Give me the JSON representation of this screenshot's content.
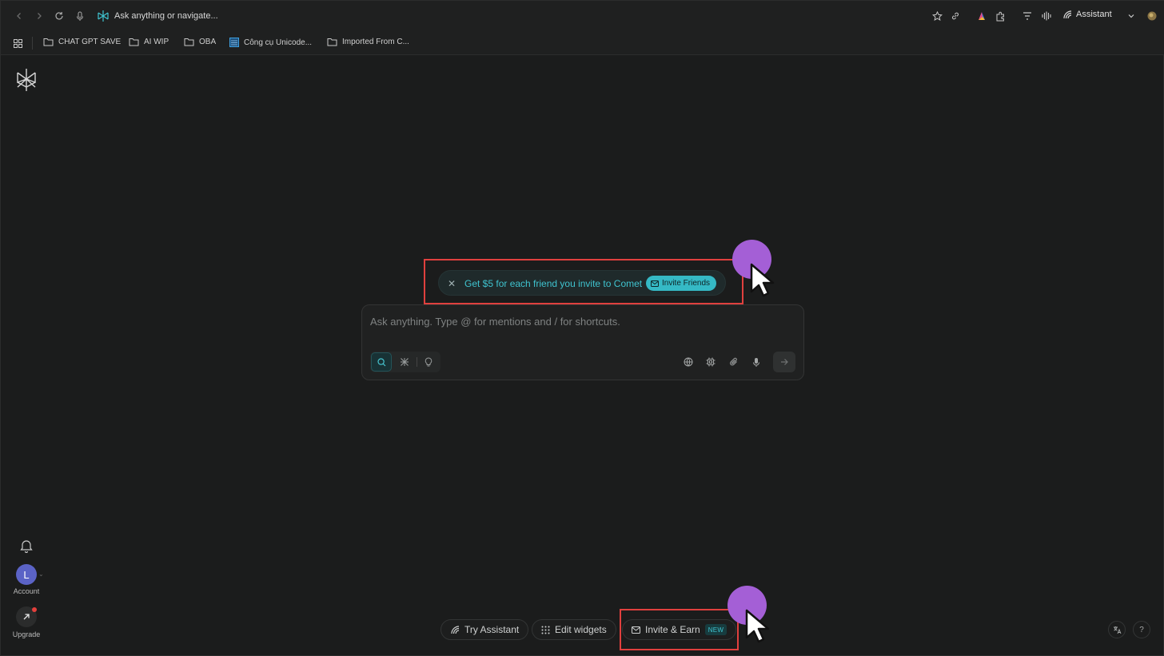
{
  "toolbar": {
    "omnibox_placeholder": "Ask anything or navigate...",
    "assistant_label": "Assistant"
  },
  "bookmarks": [
    {
      "label": "CHAT GPT SAVE",
      "icon": "folder-icon"
    },
    {
      "label": "AI WIP",
      "icon": "folder-icon"
    },
    {
      "label": "OBA",
      "icon": "folder-icon"
    },
    {
      "label": "Công cụ Unicode...",
      "icon": "unicode-icon"
    },
    {
      "label": "Imported From C...",
      "icon": "folder-icon"
    }
  ],
  "sidebar": {
    "avatar_initial": "L",
    "account_label": "Account",
    "upgrade_label": "Upgrade"
  },
  "promo": {
    "text": "Get $5 for each friend you invite to Comet",
    "button_label": "Invite Friends"
  },
  "composer": {
    "placeholder": "Ask anything. Type @ for mentions and / for shortcuts."
  },
  "bottom": {
    "try_assistant": "Try Assistant",
    "edit_widgets": "Edit widgets",
    "invite_earn": "Invite & Earn",
    "new_badge": "NEW"
  },
  "colors": {
    "background": "#1b1c1c",
    "accent": "#3fc3cf",
    "highlight": "#e0403e",
    "cursor_dot": "#a45fd6",
    "avatar": "#5b63c6"
  }
}
